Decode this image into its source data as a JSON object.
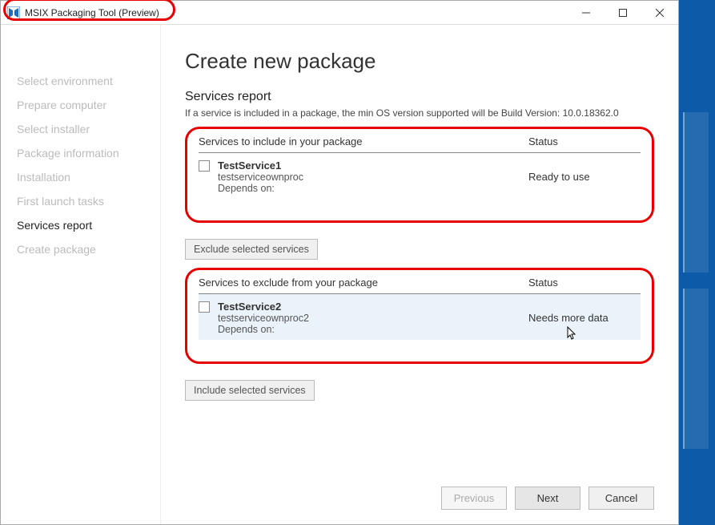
{
  "window": {
    "title": "MSIX Packaging Tool (Preview)"
  },
  "sidebar": {
    "items": [
      {
        "label": "Select environment"
      },
      {
        "label": "Prepare computer"
      },
      {
        "label": "Select installer"
      },
      {
        "label": "Package information"
      },
      {
        "label": "Installation"
      },
      {
        "label": "First launch tasks"
      },
      {
        "label": "Services report"
      },
      {
        "label": "Create package"
      }
    ],
    "active": 6
  },
  "main": {
    "title": "Create new package",
    "heading": "Services report",
    "note": "If a service is included in a package, the min OS version supported will be Build Version: 10.0.18362.0",
    "include": {
      "header_left": "Services to include in your package",
      "header_right": "Status",
      "rows": [
        {
          "name": "TestService1",
          "proc": "testserviceownproc",
          "depends": "Depends on:",
          "status": "Ready to use",
          "checked": false
        }
      ]
    },
    "exclude_btn": "Exclude selected services",
    "include_btn": "Include selected services",
    "exclude": {
      "header_left": "Services to exclude from your package",
      "header_right": "Status",
      "rows": [
        {
          "name": "TestService2",
          "proc": "testserviceownproc2",
          "depends": "Depends on:",
          "status": "Needs more data",
          "checked": false
        }
      ]
    }
  },
  "footer": {
    "previous": "Previous",
    "next": "Next",
    "cancel": "Cancel"
  }
}
